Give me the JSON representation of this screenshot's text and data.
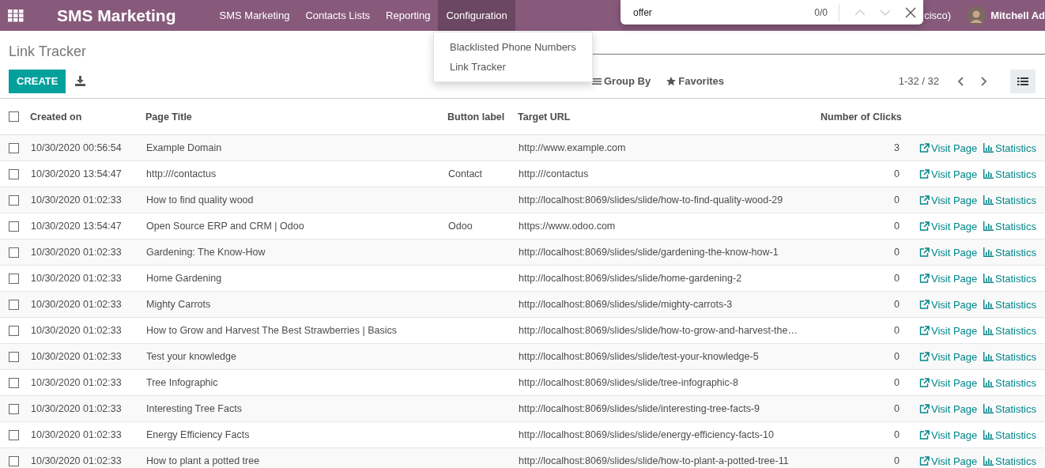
{
  "navbar": {
    "app_name": "SMS Marketing",
    "menu": [
      {
        "label": "SMS Marketing",
        "selected": false
      },
      {
        "label": "Contacts Lists",
        "selected": false
      },
      {
        "label": "Reporting",
        "selected": false
      },
      {
        "label": "Configuration",
        "selected": true
      }
    ],
    "company": "cisco)",
    "user": "Mitchell Ad"
  },
  "find_bar": {
    "query": "offer",
    "count": "0/0"
  },
  "dropdown": {
    "items": [
      "Blacklisted Phone Numbers",
      "Link Tracker"
    ]
  },
  "control_panel": {
    "breadcrumb": "Link Tracker",
    "create": "CREATE",
    "group_by": "Group By",
    "favorites": "Favorites",
    "pager": "1-32 / 32"
  },
  "table": {
    "columns": [
      "Created on",
      "Page Title",
      "Button label",
      "Target URL",
      "Number of Clicks"
    ],
    "all_checked": false,
    "rows": [
      {
        "checked": false,
        "created_on": "10/30/2020 00:56:54",
        "page_title": "Example Domain",
        "button_label": "",
        "target_url": "http://www.example.com",
        "clicks": "3",
        "visit": "Visit Page",
        "stats": "Statistics"
      },
      {
        "checked": false,
        "created_on": "10/30/2020 13:54:47",
        "page_title": "http:///contactus",
        "button_label": "Contact",
        "target_url": "http:///contactus",
        "clicks": "0",
        "visit": "Visit Page",
        "stats": "Statistics"
      },
      {
        "checked": false,
        "created_on": "10/30/2020 01:02:33",
        "page_title": "How to find quality wood",
        "button_label": "",
        "target_url": "http://localhost:8069/slides/slide/how-to-find-quality-wood-29",
        "clicks": "0",
        "visit": "Visit Page",
        "stats": "Statistics"
      },
      {
        "checked": false,
        "created_on": "10/30/2020 13:54:47",
        "page_title": "Open Source ERP and CRM | Odoo",
        "button_label": "Odoo",
        "target_url": "https://www.odoo.com",
        "clicks": "0",
        "visit": "Visit Page",
        "stats": "Statistics"
      },
      {
        "checked": false,
        "created_on": "10/30/2020 01:02:33",
        "page_title": "Gardening: The Know-How",
        "button_label": "",
        "target_url": "http://localhost:8069/slides/slide/gardening-the-know-how-1",
        "clicks": "0",
        "visit": "Visit Page",
        "stats": "Statistics"
      },
      {
        "checked": false,
        "created_on": "10/30/2020 01:02:33",
        "page_title": "Home Gardening",
        "button_label": "",
        "target_url": "http://localhost:8069/slides/slide/home-gardening-2",
        "clicks": "0",
        "visit": "Visit Page",
        "stats": "Statistics"
      },
      {
        "checked": false,
        "created_on": "10/30/2020 01:02:33",
        "page_title": "Mighty Carrots",
        "button_label": "",
        "target_url": "http://localhost:8069/slides/slide/mighty-carrots-3",
        "clicks": "0",
        "visit": "Visit Page",
        "stats": "Statistics"
      },
      {
        "checked": false,
        "created_on": "10/30/2020 01:02:33",
        "page_title": "How to Grow and Harvest The Best Strawberries | Basics",
        "button_label": "",
        "target_url": "http://localhost:8069/slides/slide/how-to-grow-and-harvest-the…",
        "clicks": "0",
        "visit": "Visit Page",
        "stats": "Statistics"
      },
      {
        "checked": false,
        "created_on": "10/30/2020 01:02:33",
        "page_title": "Test your knowledge",
        "button_label": "",
        "target_url": "http://localhost:8069/slides/slide/test-your-knowledge-5",
        "clicks": "0",
        "visit": "Visit Page",
        "stats": "Statistics"
      },
      {
        "checked": false,
        "created_on": "10/30/2020 01:02:33",
        "page_title": "Tree Infographic",
        "button_label": "",
        "target_url": "http://localhost:8069/slides/slide/tree-infographic-8",
        "clicks": "0",
        "visit": "Visit Page",
        "stats": "Statistics"
      },
      {
        "checked": false,
        "created_on": "10/30/2020 01:02:33",
        "page_title": "Interesting Tree Facts",
        "button_label": "",
        "target_url": "http://localhost:8069/slides/slide/interesting-tree-facts-9",
        "clicks": "0",
        "visit": "Visit Page",
        "stats": "Statistics"
      },
      {
        "checked": false,
        "created_on": "10/30/2020 01:02:33",
        "page_title": "Energy Efficiency Facts",
        "button_label": "",
        "target_url": "http://localhost:8069/slides/slide/energy-efficiency-facts-10",
        "clicks": "0",
        "visit": "Visit Page",
        "stats": "Statistics"
      },
      {
        "checked": false,
        "created_on": "10/30/2020 01:02:33",
        "page_title": "How to plant a potted tree",
        "button_label": "",
        "target_url": "http://localhost:8069/slides/slide/how-to-plant-a-potted-tree-11",
        "clicks": "0",
        "visit": "Visit Page",
        "stats": "Statistics"
      }
    ]
  }
}
